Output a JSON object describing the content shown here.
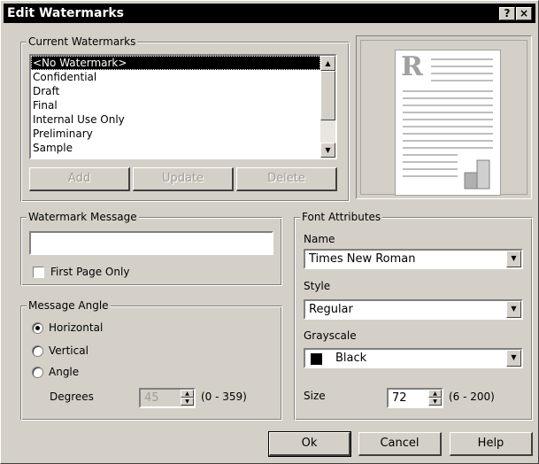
{
  "window": {
    "title": "Edit Watermarks",
    "help_btn": "?",
    "close_btn": "×"
  },
  "current_watermarks": {
    "legend": "Current Watermarks",
    "items": [
      "<No Watermark>",
      "Confidential",
      "Draft",
      "Final",
      "Internal Use Only",
      "Preliminary",
      "Sample"
    ],
    "selected_index": 0,
    "buttons": {
      "add": "Add",
      "update": "Update",
      "delete": "Delete"
    }
  },
  "preview": {
    "letter": "R"
  },
  "watermark_message": {
    "legend": "Watermark Message",
    "text_value": "",
    "first_page_only_label": "First Page Only",
    "first_page_only_checked": false
  },
  "message_angle": {
    "legend": "Message Angle",
    "options": [
      "Horizontal",
      "Vertical",
      "Angle"
    ],
    "selected": "Horizontal",
    "degrees_label": "Degrees",
    "degrees_value": "45",
    "degrees_range": "(0 - 359)"
  },
  "font_attributes": {
    "legend": "Font Attributes",
    "name_label": "Name",
    "name_value": "Times New Roman",
    "style_label": "Style",
    "style_value": "Regular",
    "grayscale_label": "Grayscale",
    "grayscale_value": "Black",
    "grayscale_color": "#000000",
    "size_label": "Size",
    "size_value": "72",
    "size_range": "(6 - 200)"
  },
  "footer": {
    "ok": "Ok",
    "cancel": "Cancel",
    "help": "Help"
  }
}
